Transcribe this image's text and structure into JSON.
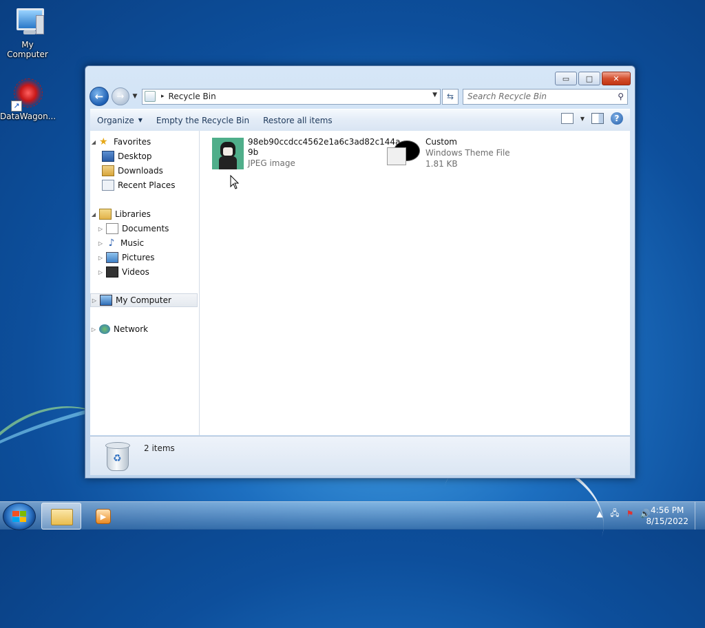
{
  "desktop": {
    "icons": [
      {
        "label": "My Computer",
        "icon": "computer-icon"
      },
      {
        "label": "DataWagon...",
        "icon": "datawagon-icon"
      }
    ]
  },
  "window": {
    "caption_buttons": {
      "minimize": "▭",
      "maximize": "□",
      "close": "✕"
    },
    "address": {
      "path": "Recycle Bin",
      "separator": "▸"
    },
    "search": {
      "placeholder": "Search Recycle Bin"
    },
    "toolbar": {
      "organize": "Organize",
      "empty": "Empty the Recycle Bin",
      "restore": "Restore all items"
    },
    "nav": {
      "favorites": "Favorites",
      "desktop": "Desktop",
      "downloads": "Downloads",
      "recent": "Recent Places",
      "libraries": "Libraries",
      "documents": "Documents",
      "music": "Music",
      "pictures": "Pictures",
      "videos": "Videos",
      "computer": "My Computer",
      "network": "Network"
    },
    "files": [
      {
        "name_line1": "98eb90ccdcc4562e1a6c3ad82c144a",
        "name_line2": "9b",
        "type": "JPEG image"
      },
      {
        "name": "Custom",
        "type": "Windows Theme File",
        "size": "1.81 KB"
      }
    ],
    "status": {
      "count": "2 items"
    }
  },
  "taskbar": {
    "clock_time": "4:56 PM",
    "clock_date": "8/15/2022"
  },
  "colors": {
    "accent": "#1d6fc0",
    "close_red": "#c23512"
  }
}
